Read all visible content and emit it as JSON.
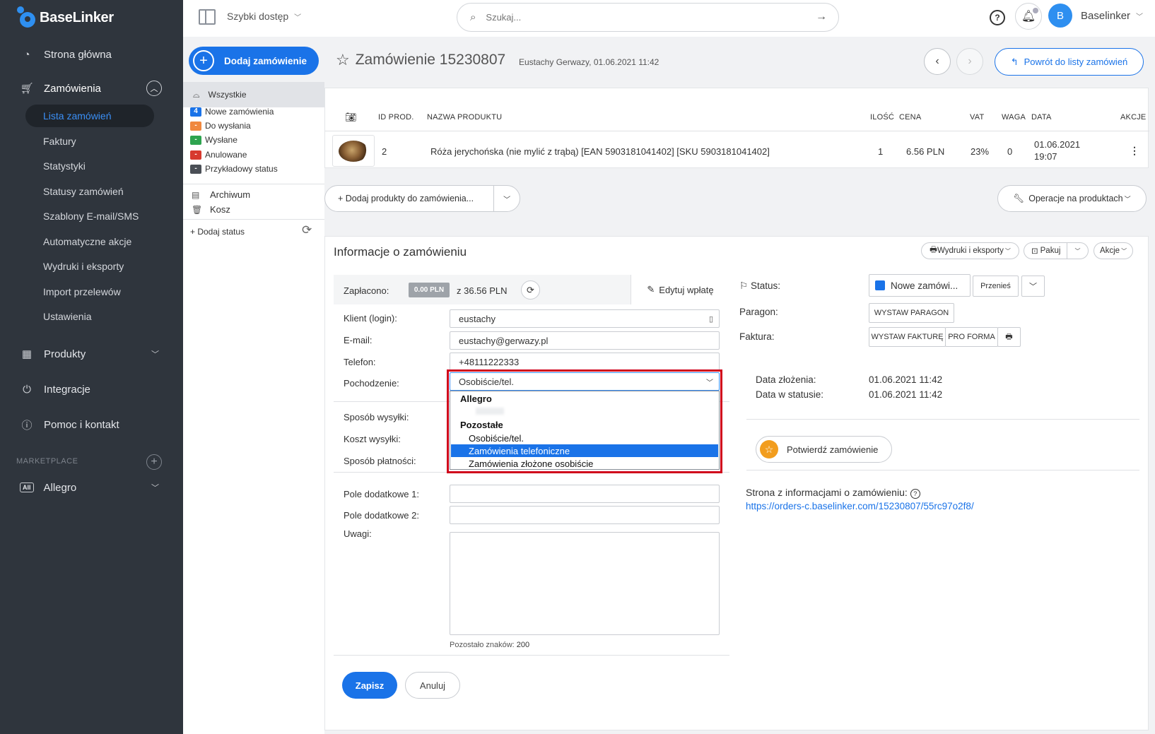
{
  "app": {
    "brand": "BaseLinker"
  },
  "sidebar": {
    "items": [
      {
        "label": "Strona główna"
      },
      {
        "label": "Zamówienia"
      },
      {
        "label": "Produkty"
      },
      {
        "label": "Integracje"
      },
      {
        "label": "Pomoc i kontakt"
      }
    ],
    "orders_sub": [
      {
        "label": "Lista zamówień"
      },
      {
        "label": "Faktury"
      },
      {
        "label": "Statystyki"
      },
      {
        "label": "Statusy zamówień"
      },
      {
        "label": "Szablony E-mail/SMS"
      },
      {
        "label": "Automatyczne akcje"
      },
      {
        "label": "Wydruki i eksporty"
      },
      {
        "label": "Import przelewów"
      },
      {
        "label": "Ustawienia"
      }
    ],
    "marketplace_label": "MARKETPLACE",
    "marketplace_badge": "All",
    "marketplace_item": "Allegro"
  },
  "topbar": {
    "quick_access": "Szybki dostęp",
    "search_placeholder": "Szukaj...",
    "avatar_letter": "B",
    "user_name": "Baselinker"
  },
  "status_panel": {
    "add_order": "Dodaj zamówienie",
    "all": "Wszystkie",
    "statuses": [
      {
        "badge": "4",
        "label": "Nowe zamówienia",
        "color": "#1a73e8"
      },
      {
        "badge": "-",
        "label": "Do wysłania",
        "color": "#f0883e"
      },
      {
        "badge": "-",
        "label": "Wysłane",
        "color": "#2ea44f"
      },
      {
        "badge": "-",
        "label": "Anulowane",
        "color": "#d73a2f"
      },
      {
        "badge": "-",
        "label": "Przykładowy status",
        "color": "#4a4f56"
      }
    ],
    "archive": "Archiwum",
    "trash": "Kosz",
    "add_status": "+ Dodaj status"
  },
  "order": {
    "title": "Zamówienie 15230807",
    "subtitle": "Eustachy Gerwazy, 01.06.2021 11:42",
    "back_button": "Powrót do listy zamówień"
  },
  "products": {
    "headers": {
      "id": "ID PROD.",
      "name": "NAZWA PRODUKTU",
      "qty": "ILOŚĆ",
      "price": "CENA",
      "vat": "VAT",
      "weight": "WAGA",
      "date": "DATA",
      "actions": "AKCJE"
    },
    "rows": [
      {
        "id": "2",
        "name": "Róża jerychońska (nie mylić z trąbą) [EAN 5903181041402] [SKU 5903181041402]",
        "qty": "1",
        "price": "6.56 PLN",
        "vat": "23%",
        "weight": "0",
        "date": "01.06.2021",
        "time": "19:07"
      }
    ],
    "add_products": "Dodaj produkty do zamówienia...",
    "operations": "Operacje na produktach"
  },
  "info": {
    "title": "Informacje o zamówieniu",
    "prints": "Wydruki i eksporty",
    "pack": "Pakuj",
    "actions": "Akcje",
    "paid_label": "Zapłacono:",
    "paid_value": "0.00 PLN",
    "paid_total": "z 36.56 PLN",
    "edit_payment": "Edytuj wpłatę",
    "fields": {
      "client_label": "Klient (login):",
      "client_value": "eustachy",
      "email_label": "E-mail:",
      "email_value": "eustachy@gerwazy.pl",
      "phone_label": "Telefon:",
      "phone_value": "+48111222333",
      "origin_label": "Pochodzenie:",
      "origin_value": "Osobiście/tel.",
      "shipping_method_label": "Sposób wysyłki:",
      "shipping_cost_label": "Koszt wysyłki:",
      "payment_method_label": "Sposób płatności:",
      "extra1_label": "Pole dodatkowe 1:",
      "extra2_label": "Pole dodatkowe 2:",
      "notes_label": "Uwagi:"
    },
    "chars_left_label": "Pozostało znaków:",
    "chars_left_value": "200",
    "save": "Zapisz",
    "cancel": "Anuluj",
    "origin_dropdown": {
      "group1": "Allegro",
      "group2": "Pozostałe",
      "options": [
        {
          "label": "Osobiście/tel."
        },
        {
          "label": "Zamówienia telefoniczne",
          "selected": true
        },
        {
          "label": "Zamówienia złożone osobiście"
        }
      ]
    }
  },
  "right": {
    "status_label": "Status:",
    "status_value": "Nowe zamówi...",
    "move": "Przenieś",
    "receipt_label": "Paragon:",
    "receipt_btn": "WYSTAW PARAGON",
    "invoice_label": "Faktura:",
    "invoice_btn": "WYSTAW FAKTURĘ",
    "proforma_btn": "PRO FORMA",
    "date_created_label": "Data złożenia:",
    "date_created_value": "01.06.2021 11:42",
    "date_status_label": "Data w statusie:",
    "date_status_value": "01.06.2021 11:42",
    "confirm": "Potwierdź zamówienie",
    "info_page_label": "Strona z informacjami o zamówieniu:",
    "info_page_url": "https://orders-c.baselinker.com/15230807/55rc97o2f8/"
  }
}
